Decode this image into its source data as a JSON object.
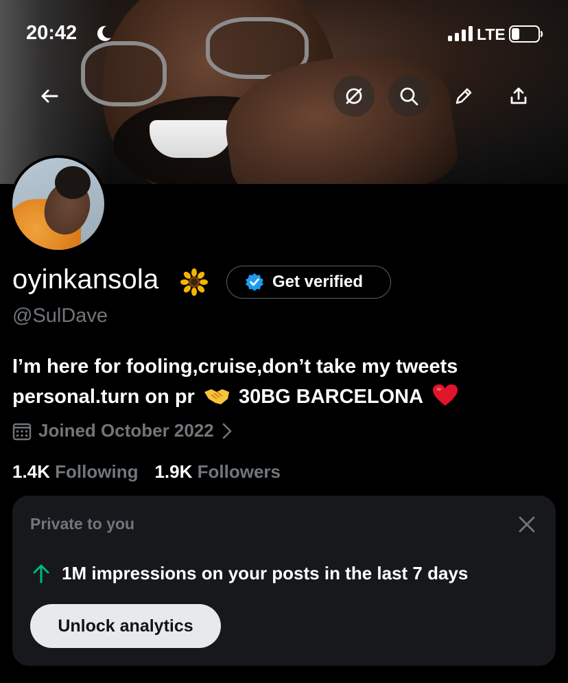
{
  "status_bar": {
    "time": "20:42",
    "network": "LTE"
  },
  "banner_nav": {
    "back_icon": "arrow-left-icon",
    "icons": [
      "hide-icon",
      "search-icon",
      "edit-icon",
      "share-icon"
    ]
  },
  "profile": {
    "display_name": "oyinkansola",
    "name_emoji": "sunflower",
    "get_verified_label": "Get verified",
    "handle": "@SulDave",
    "bio_line1": "I’m here for fooling,cruise,don’t take my tweets",
    "bio_line2_part1": "personal.turn on pr",
    "bio_line2_part2": "30BG BARCELONA",
    "joined": "Joined October 2022",
    "following_count": "1.4K",
    "following_label": "Following",
    "followers_count": "1.9K",
    "followers_label": "Followers"
  },
  "private_card": {
    "title": "Private to you",
    "impressions_text": "1M impressions on your posts in the last 7 days",
    "unlock_button": "Unlock analytics"
  },
  "colors": {
    "background": "#000000",
    "secondary_text": "#71767b",
    "verified_blue": "#1d9bf0",
    "trend_green": "#00ba7c",
    "card_bg": "#16181c"
  }
}
